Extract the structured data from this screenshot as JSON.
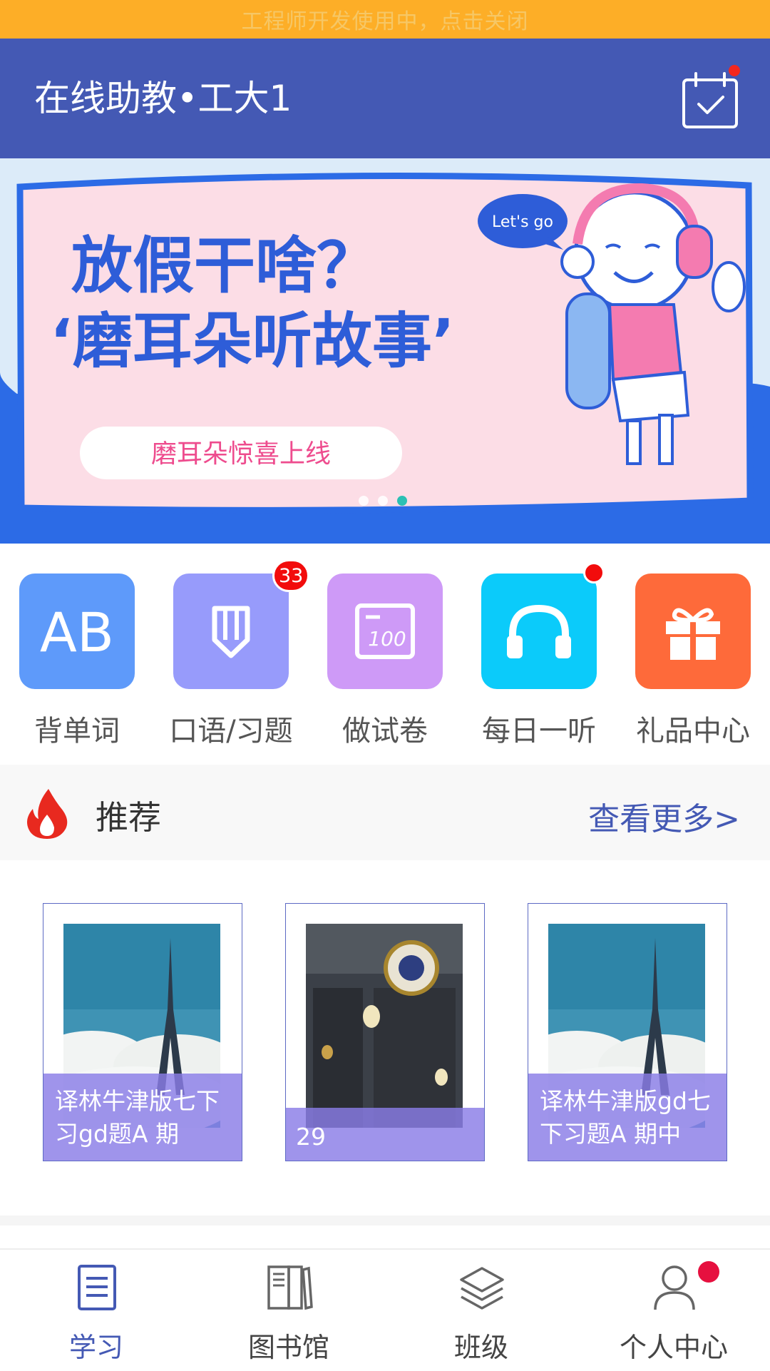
{
  "dev_notice": "工程师开发使用中，点击关闭",
  "header": {
    "title": "在线助教•工大1",
    "calendar_icon": "calendar-check-icon",
    "has_notification": true
  },
  "banner": {
    "line1": "放假干啥？",
    "line2": "‘磨耳朵听故事’",
    "button_text": "磨耳朵惊喜上线",
    "bubble_text": "Let's go",
    "pages": 3,
    "active_page": 3
  },
  "menu": [
    {
      "label": "背单词",
      "icon": "ab-letters-icon",
      "color": "#5E9AFA"
    },
    {
      "label": "口语/习题",
      "icon": "pencil-icon",
      "color": "#979BFB",
      "badge": "33"
    },
    {
      "label": "做试卷",
      "icon": "exam-paper-icon",
      "color": "#CE9AF7"
    },
    {
      "label": "每日一听",
      "icon": "headphones-icon",
      "color": "#0BCBFA",
      "dot": true
    },
    {
      "label": "礼品中心",
      "icon": "gift-icon",
      "color": "#FE6A3A"
    }
  ],
  "recommend": {
    "title": "推荐",
    "more": "查看更多>"
  },
  "cards": [
    {
      "caption": "译林牛津版七下习gd题A 期",
      "image": "eiffel-tower"
    },
    {
      "caption": "29",
      "image": "storefront"
    },
    {
      "caption": "译林牛津版gd七下习题A 期中",
      "image": "eiffel-tower"
    }
  ],
  "tabs": [
    {
      "label": "学习",
      "icon": "study-icon",
      "active": true
    },
    {
      "label": "图书馆",
      "icon": "library-icon"
    },
    {
      "label": "班级",
      "icon": "layers-icon"
    },
    {
      "label": "个人中心",
      "icon": "person-icon",
      "dot": true
    }
  ],
  "colors": {
    "header": "#4459B4",
    "dev_bar": "#FDAE27",
    "accent": "#4459B4"
  }
}
